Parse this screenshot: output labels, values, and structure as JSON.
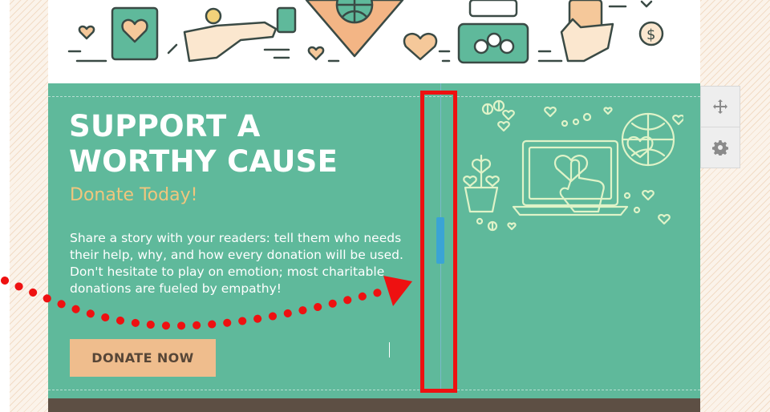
{
  "hero": {
    "title_line1": "SUPPORT A",
    "title_line2": "WORTHY CAUSE",
    "subtitle": "Donate Today!",
    "body": "Share a story with your readers: tell them who needs their help, why, and how every donation will be used. Don't hesitate to play on emotion; most charitable donations are fueled by empathy!",
    "cta_label": "DONATE NOW"
  },
  "colors": {
    "hero_background": "#5fb99b",
    "title_text": "#ffffff",
    "subtitle_text": "#f1c67d",
    "cta_background": "#efbd8d",
    "cta_text": "#574637",
    "resize_handle": "#3aa4d5",
    "highlight": "#ee1111",
    "footer": "#5d4f44"
  },
  "toolbar": {
    "move_icon": "move-icon",
    "settings_icon": "gear-icon"
  },
  "header_illustration": {
    "icons": [
      "heart-card-icon",
      "hand-coin-icon",
      "heart-globe-icon",
      "hearts-icon",
      "coin-jar-icon",
      "hand-card-icon",
      "dollar-coin-icon"
    ]
  },
  "hero_illustration": {
    "icons": [
      "plant-pot-icon",
      "laptop-heart-icon",
      "pointing-hand-icon",
      "globe-icon",
      "hearts-icon",
      "coins-icon"
    ]
  },
  "annotation": {
    "type": "dotted-arrow",
    "target": "column-resize-handle"
  }
}
